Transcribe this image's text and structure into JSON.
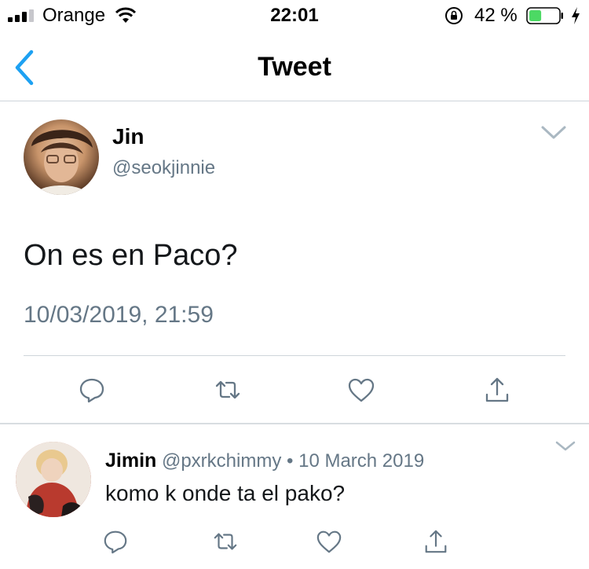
{
  "status_bar": {
    "carrier": "Orange",
    "time": "22:01",
    "battery_percent": "42 %",
    "battery_level": 0.42,
    "icons": [
      "signal-icon",
      "wifi-icon",
      "orientation-lock-icon",
      "battery-icon",
      "charging-icon"
    ]
  },
  "nav": {
    "title": "Tweet",
    "back_icon": "back-chevron-icon"
  },
  "tweet": {
    "name": "Jin",
    "handle": "@seokjinnie",
    "text": "On es en Paco?",
    "timestamp": "10/03/2019, 21:59",
    "actions": [
      "reply-icon",
      "retweet-icon",
      "like-icon",
      "share-icon"
    ]
  },
  "reply": {
    "name": "Jimin",
    "handle": "@pxrkchimmy",
    "separator": "•",
    "date": "10 March 2019",
    "text": "komo k onde ta el pako?",
    "actions": [
      "reply-icon",
      "retweet-icon",
      "like-icon",
      "share-icon"
    ]
  },
  "colors": {
    "accent": "#1da1f2",
    "secondary_text": "#657786",
    "icon_gray": "#657786",
    "battery_green": "#4cd964",
    "divider": "#cfd5da"
  }
}
